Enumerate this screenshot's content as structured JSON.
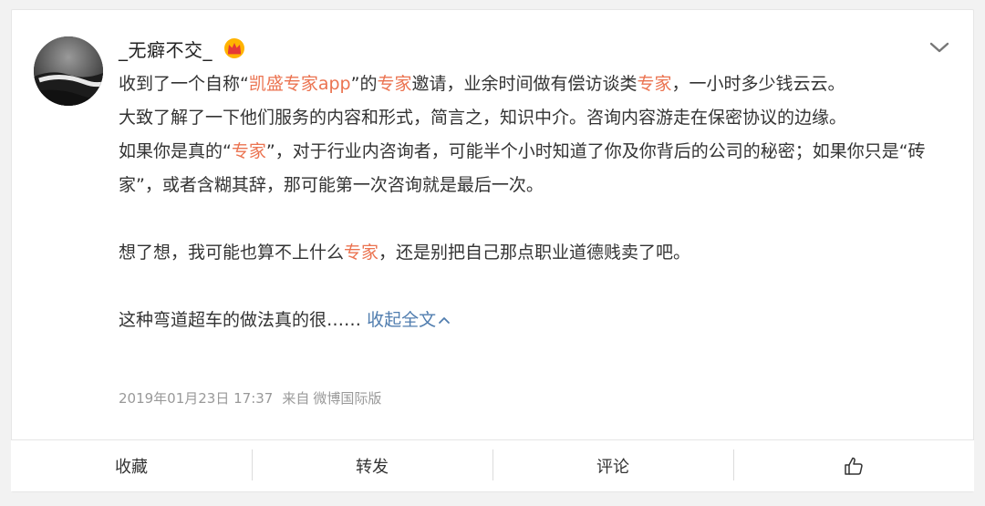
{
  "post": {
    "username": "_无癖不交_",
    "badge_icon": "crown-icon",
    "lines": {
      "l1_a": "收到了一个自称“",
      "l1_app": "凯盛专家app",
      "l1_b": "”的",
      "l1_expert": "专家",
      "l1_c": "邀请，业余时间做有偿访谈类",
      "l1_expert2": "专家",
      "l1_d": "，一小时多少钱云云。",
      "p2": "大致了解了一下他们服务的内容和形式，简言之，知识中介。咨询内容游走在保密协议的边缘。",
      "p3_a": "如果你是真的“",
      "p3_expert": "专家",
      "p3_b": "”，对于行业内咨询者，可能半个小时知道了你及你背后的公司的秘密；如果你只是“砖家”，或者含糊其辞，那可能第一次咨询就是最后一次。",
      "p4_a": "想了想，我可能也算不上什么",
      "p4_expert": "专家",
      "p4_b": "，还是别把自己那点职业道德贱卖了吧。",
      "p5": "这种弯道超车的做法真的很……",
      "collapse": "收起全文"
    },
    "timestamp": "2019年01月23日 17:37",
    "source_prefix": "来自",
    "source": "微博国际版"
  },
  "actions": {
    "favorite": "收藏",
    "repost": "转发",
    "comment": "评论",
    "like_icon": "thumbs-up-icon"
  },
  "colors": {
    "highlight": "#eb7350",
    "link": "#507daf"
  }
}
